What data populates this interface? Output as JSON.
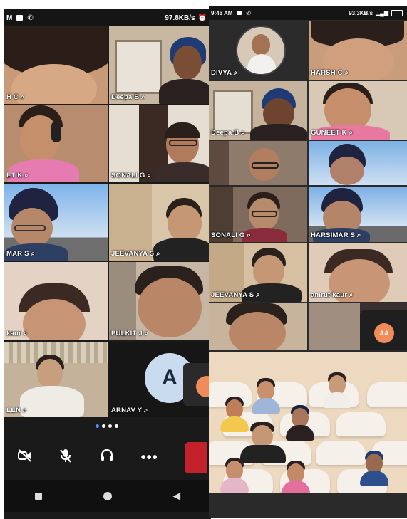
{
  "left_phone": {
    "status": {
      "time": "M",
      "speed": "97.8KB/s"
    },
    "participants": [
      {
        "label": "H C"
      },
      {
        "label": "Deepa B"
      },
      {
        "label": "ET K"
      },
      {
        "label": "SONALI G"
      },
      {
        "label": "MAR S"
      },
      {
        "label": "JEEVANYA S"
      },
      {
        "label": "kaur"
      },
      {
        "label": "PULKIT J"
      },
      {
        "label": "EEN"
      },
      {
        "label": "ARNAV Y",
        "initial": "A"
      }
    ],
    "pager": {
      "count": 4,
      "active": 0
    },
    "controls": [
      "video-off",
      "mic-off",
      "audio",
      "more",
      "leave"
    ],
    "nav": [
      "recents",
      "home",
      "back"
    ]
  },
  "right_phone": {
    "status": {
      "time": "9:46 AM",
      "speed": "93.3KB/s"
    },
    "participants": [
      {
        "label": "DIVYA"
      },
      {
        "label": "HARSH C"
      },
      {
        "label": "Deepa B"
      },
      {
        "label": "GUNEET K"
      },
      {
        "label": ""
      },
      {
        "label": ""
      },
      {
        "label": "SONALI G"
      },
      {
        "label": "HARSIMAR S"
      },
      {
        "label": "JEEVANYA S"
      },
      {
        "label": "amrut kaur"
      },
      {
        "label": ""
      },
      {
        "label": "AA",
        "initial": "AA"
      }
    ]
  },
  "colors": {
    "avatar_light_blue": "#c9dcef",
    "avatar_orange": "#f08c5a",
    "leave_red": "#c3222c",
    "pager_active": "#4b8df8"
  }
}
